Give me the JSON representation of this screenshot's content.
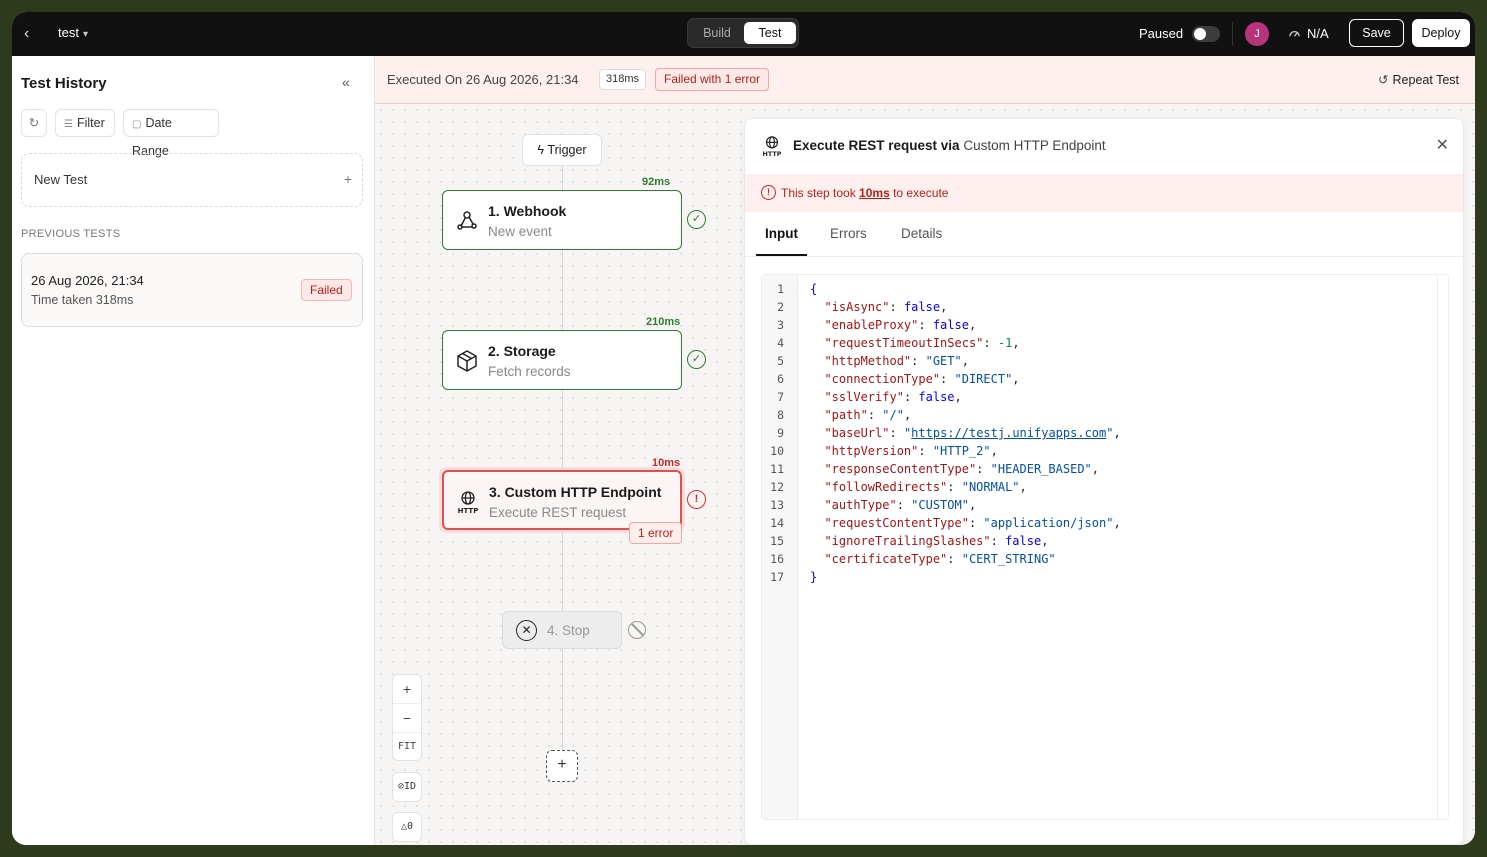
{
  "topbar": {
    "project_name": "test",
    "mode_tabs": [
      "Build",
      "Test"
    ],
    "active_mode": "Test",
    "paused_label": "Paused",
    "paused_on": false,
    "avatar_initial": "J",
    "avatar_color": "#b8347a",
    "na_label": "N/A",
    "save_label": "Save",
    "deploy_label": "Deploy"
  },
  "sidebar": {
    "title": "Test History",
    "filter_label": "Filter",
    "date_range_label": "Date Range",
    "new_test_label": "New Test",
    "previous_label": "PREVIOUS TESTS",
    "tests": [
      {
        "date": "26 Aug 2026, 21:34",
        "time_taken": "Time taken 318ms",
        "status": "Failed"
      }
    ]
  },
  "execbar": {
    "executed_on": "Executed On 26 Aug 2026, 21:34",
    "duration": "318ms",
    "error_summary": "Failed with 1 error",
    "repeat_label": "Repeat Test"
  },
  "flow": {
    "trigger_label": "Trigger",
    "nodes": [
      {
        "title": "1. Webhook",
        "subtitle": "New event",
        "time": "92ms",
        "status": "success",
        "icon": "webhook-icon"
      },
      {
        "title": "2. Storage",
        "subtitle": "Fetch records",
        "time": "210ms",
        "status": "success",
        "icon": "box-icon"
      },
      {
        "title": "3. Custom HTTP Endpoint",
        "subtitle": "Execute REST request",
        "time": "10ms",
        "status": "error",
        "icon": "http-globe-icon",
        "error_count": "1 error"
      }
    ],
    "stop_node": {
      "label": "4. Stop",
      "status": "skipped"
    },
    "controls": {
      "zoom_in": "+",
      "zoom_out": "−",
      "fit": "FIT",
      "id_toggle": "ID",
      "warnings": "0"
    }
  },
  "panel": {
    "title_action": "Execute REST request via",
    "title_connector": "Custom HTTP Endpoint",
    "alert_prefix": "This step took",
    "alert_value": "10ms",
    "alert_suffix": "to execute",
    "tabs": [
      "Input",
      "Errors",
      "Details"
    ],
    "active_tab": "Input",
    "code_lines": [
      "{",
      "  \"isAsync\": false,",
      "  \"enableProxy\": false,",
      "  \"requestTimeoutInSecs\": -1,",
      "  \"httpMethod\": \"GET\",",
      "  \"connectionType\": \"DIRECT\",",
      "  \"sslVerify\": false,",
      "  \"path\": \"/\",",
      "  \"baseUrl\": \"https://testj.unifyapps.com\",",
      "  \"httpVersion\": \"HTTP_2\",",
      "  \"responseContentType\": \"HEADER_BASED\",",
      "  \"followRedirects\": \"NORMAL\",",
      "  \"authType\": \"CUSTOM\",",
      "  \"requestContentType\": \"application/json\",",
      "  \"ignoreTrailingSlashes\": false,",
      "  \"certificateType\": \"CERT_STRING\"",
      "}"
    ]
  },
  "colors": {
    "success": "#2e7d32",
    "error": "#d32f2f",
    "topbar_bg": "#111111",
    "frame_bg": "#2d3a1c"
  }
}
